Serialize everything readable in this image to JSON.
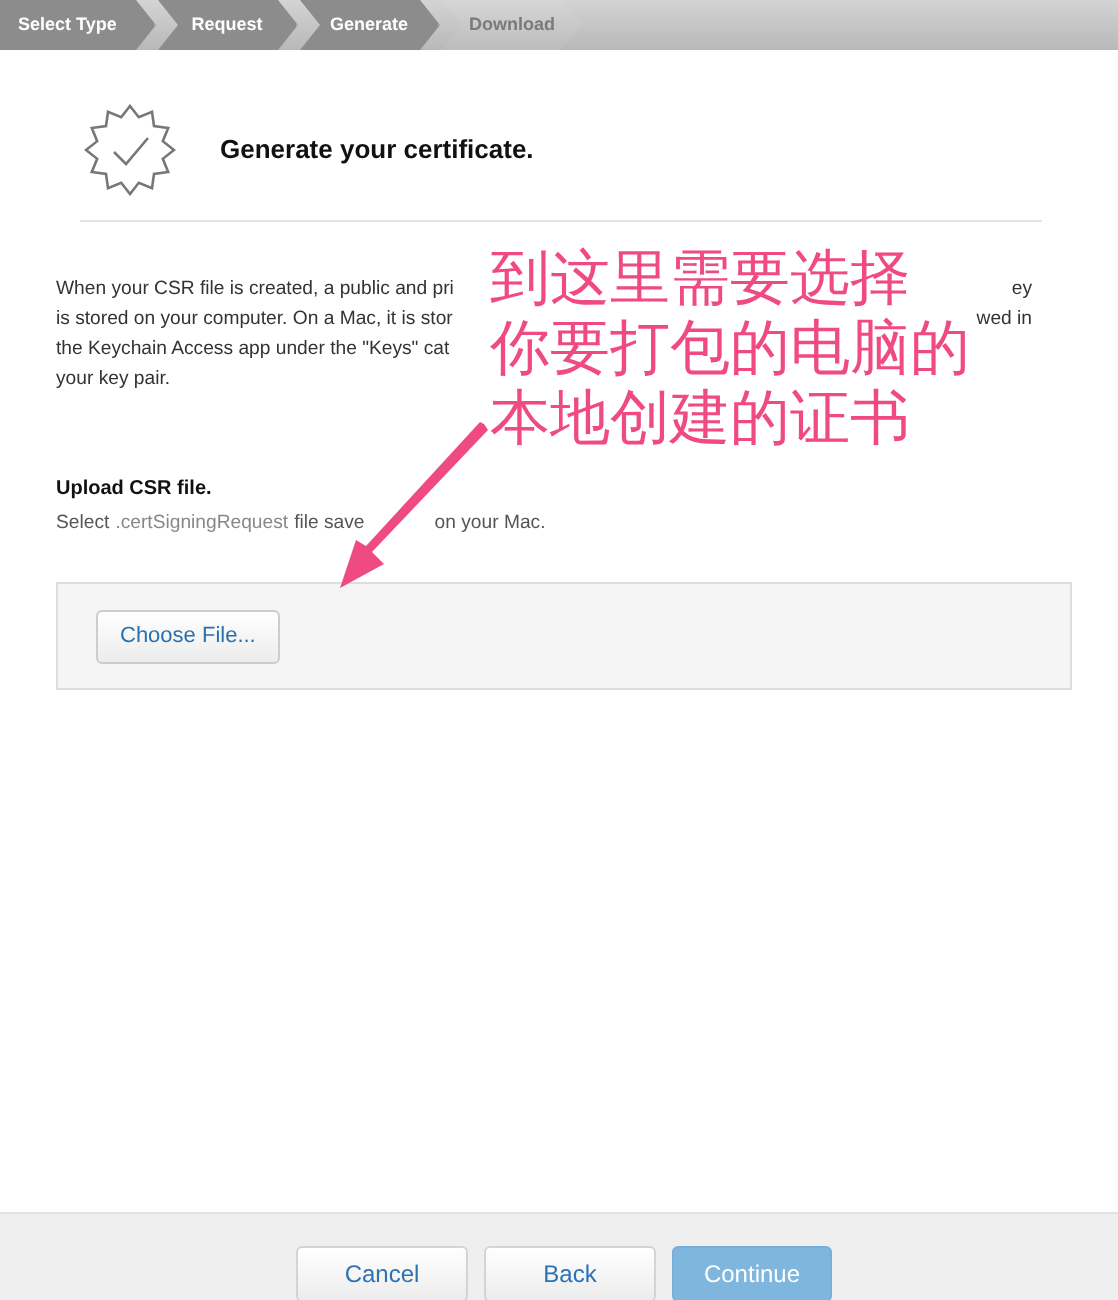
{
  "steps": [
    {
      "label": "Select Type",
      "completed": true
    },
    {
      "label": "Request",
      "completed": true
    },
    {
      "label": "Generate",
      "completed": true
    },
    {
      "label": "Download",
      "completed": false
    }
  ],
  "title": "Generate your certificate.",
  "paragraph_lines": [
    [
      "When your CSR file is created, a public and pri",
      "ey"
    ],
    [
      "is stored on your computer. On a Mac, it is stor",
      "wed in"
    ],
    [
      "the Keychain Access app under the \"Keys\" cat"
    ],
    [
      "your key pair."
    ]
  ],
  "upload": {
    "heading": "Upload CSR file.",
    "hint_parts": [
      {
        "text": "Select",
        "kind": "plain"
      },
      {
        "text": ".certSigningRequest",
        "kind": "code"
      },
      {
        "text": "file save",
        "kind": "plain"
      },
      {
        "text": "on your Mac.",
        "kind": "plain"
      }
    ],
    "button": "Choose File..."
  },
  "annotation": {
    "lines": [
      "到这里需要选择",
      "你要打包的电脑的",
      "本地创建的证书"
    ]
  },
  "buttons": [
    {
      "label": "Cancel",
      "disabled": false
    },
    {
      "label": "Back",
      "disabled": false
    },
    {
      "label": "Continue",
      "disabled": true
    }
  ]
}
